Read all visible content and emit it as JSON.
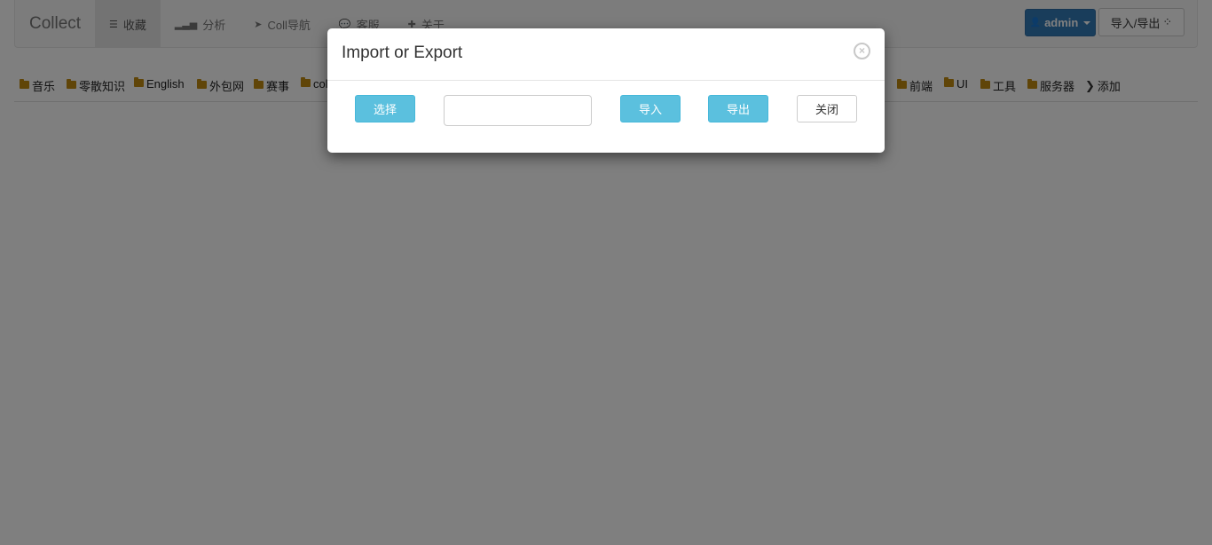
{
  "navbar": {
    "brand": "Collect",
    "items": [
      {
        "label": "收藏",
        "icon": "list-icon",
        "glyph": "☰",
        "active": true
      },
      {
        "label": "分析",
        "icon": "signal-icon",
        "glyph": "▂▃▅",
        "active": false
      },
      {
        "label": "Coll导航",
        "icon": "send-icon",
        "glyph": "➤",
        "active": false
      },
      {
        "label": "客服",
        "icon": "comments-icon",
        "glyph": "💬",
        "active": false
      },
      {
        "label": "关于",
        "icon": "puzzle-icon",
        "glyph": "✚",
        "active": false
      }
    ],
    "user_button": {
      "label": "admin",
      "icon": "user-icon",
      "glyph": "👤"
    },
    "import_export_button": {
      "label": "导入/导出",
      "icon": "spinner-icon",
      "glyph": "⁘"
    }
  },
  "categories": [
    {
      "label": "音乐"
    },
    {
      "label": "零散知识"
    },
    {
      "label": "English"
    },
    {
      "label": "外包网"
    },
    {
      "label": "赛事"
    },
    {
      "label": "coll"
    },
    {
      "label": "前端"
    },
    {
      "label": "UI"
    },
    {
      "label": "工具"
    },
    {
      "label": "服务器"
    }
  ],
  "add_category": {
    "label": "添加",
    "icon": "chevron-right-icon",
    "glyph": "❯"
  },
  "modal": {
    "title": "Import or Export",
    "close_glyph": "×",
    "choose_label": "选择",
    "file_value": "",
    "import_label": "导入",
    "export_label": "导出",
    "close_label": "关闭"
  },
  "colors": {
    "primary": "#337ab7",
    "info": "#5bc0de",
    "folder": "#c08a10",
    "backdrop": "rgba(0,0,0,0.5)"
  }
}
